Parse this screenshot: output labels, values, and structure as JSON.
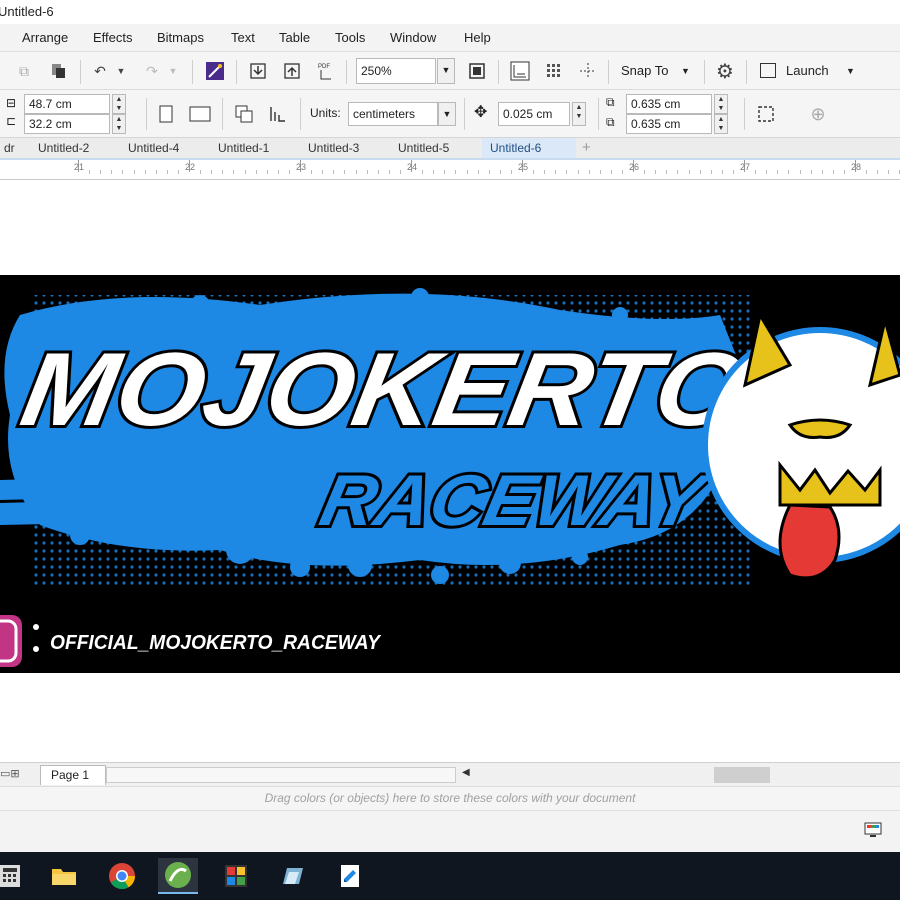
{
  "window": {
    "title": "Untitled-6"
  },
  "menu": [
    "Arrange",
    "Effects",
    "Bitmaps",
    "Text",
    "Table",
    "Tools",
    "Window",
    "Help"
  ],
  "toolbar": {
    "zoom": "250%",
    "snap_label": "Snap To",
    "launch_label": "Launch"
  },
  "properties": {
    "width": "48.7 cm",
    "height": "32.2 cm",
    "units_label": "Units:",
    "units_value": "centimeters",
    "nudge": "0.025 cm",
    "dup_x": "0.635 cm",
    "dup_y": "0.635 cm"
  },
  "tabs": [
    {
      "label": "dr",
      "active": false
    },
    {
      "label": "Untitled-2",
      "active": false
    },
    {
      "label": "Untitled-4",
      "active": false
    },
    {
      "label": "Untitled-1",
      "active": false
    },
    {
      "label": "Untitled-3",
      "active": false
    },
    {
      "label": "Untitled-5",
      "active": false
    },
    {
      "label": "Untitled-6",
      "active": true
    }
  ],
  "ruler": [
    "21",
    "22",
    "23",
    "24",
    "25",
    "26",
    "27",
    "28"
  ],
  "artwork": {
    "main_text": "MOJOKERTO",
    "sub_text": "RACEWAY",
    "handle": "OFFICIAL_MOJOKERTO_RACEWAY",
    "colors": {
      "background": "#000000",
      "blue": "#1e88e5",
      "white": "#ffffff",
      "yellow": "#e6c21a",
      "red": "#e53935"
    }
  },
  "pagebar": {
    "page_label": "Page 1"
  },
  "palette_hint": "Drag colors (or objects) here to store these colors with your document",
  "taskbar": [
    "calculator-icon",
    "file-explorer-icon",
    "chrome-icon",
    "coreldraw-icon",
    "photo-app-icon",
    "app-icon",
    "document-icon"
  ]
}
